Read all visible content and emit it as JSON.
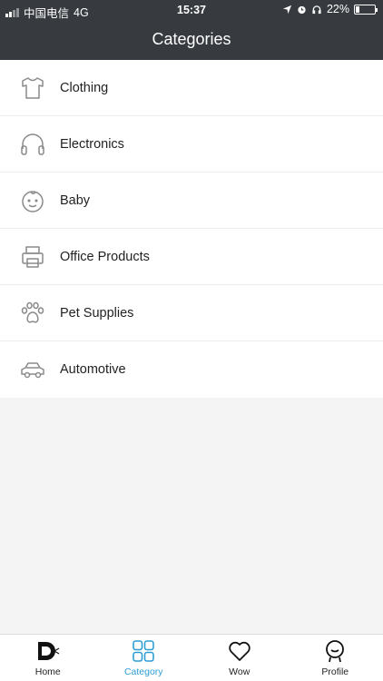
{
  "status_bar": {
    "carrier": "中国电信",
    "network": "4G",
    "time": "15:37",
    "battery": "22%",
    "battery_level": 0.22
  },
  "header": {
    "title": "Categories"
  },
  "categories": [
    {
      "label": "Clothing",
      "icon": "shirt-icon"
    },
    {
      "label": "Electronics",
      "icon": "headphones-icon"
    },
    {
      "label": "Baby",
      "icon": "baby-face-icon"
    },
    {
      "label": "Office Products",
      "icon": "printer-icon"
    },
    {
      "label": "Pet Supplies",
      "icon": "paw-icon"
    },
    {
      "label": "Automotive",
      "icon": "car-icon"
    }
  ],
  "tab_bar": {
    "items": [
      {
        "label": "Home",
        "icon": "home-logo-icon",
        "active": false
      },
      {
        "label": "Category",
        "icon": "grid-icon",
        "active": true
      },
      {
        "label": "Wow",
        "icon": "heart-icon",
        "active": false
      },
      {
        "label": "Profile",
        "icon": "person-icon",
        "active": false
      }
    ]
  },
  "colors": {
    "header_bg": "#373b40",
    "accent": "#2d9ed4",
    "icon_gray": "#8a8a8a",
    "background": "#f4f4f4"
  }
}
